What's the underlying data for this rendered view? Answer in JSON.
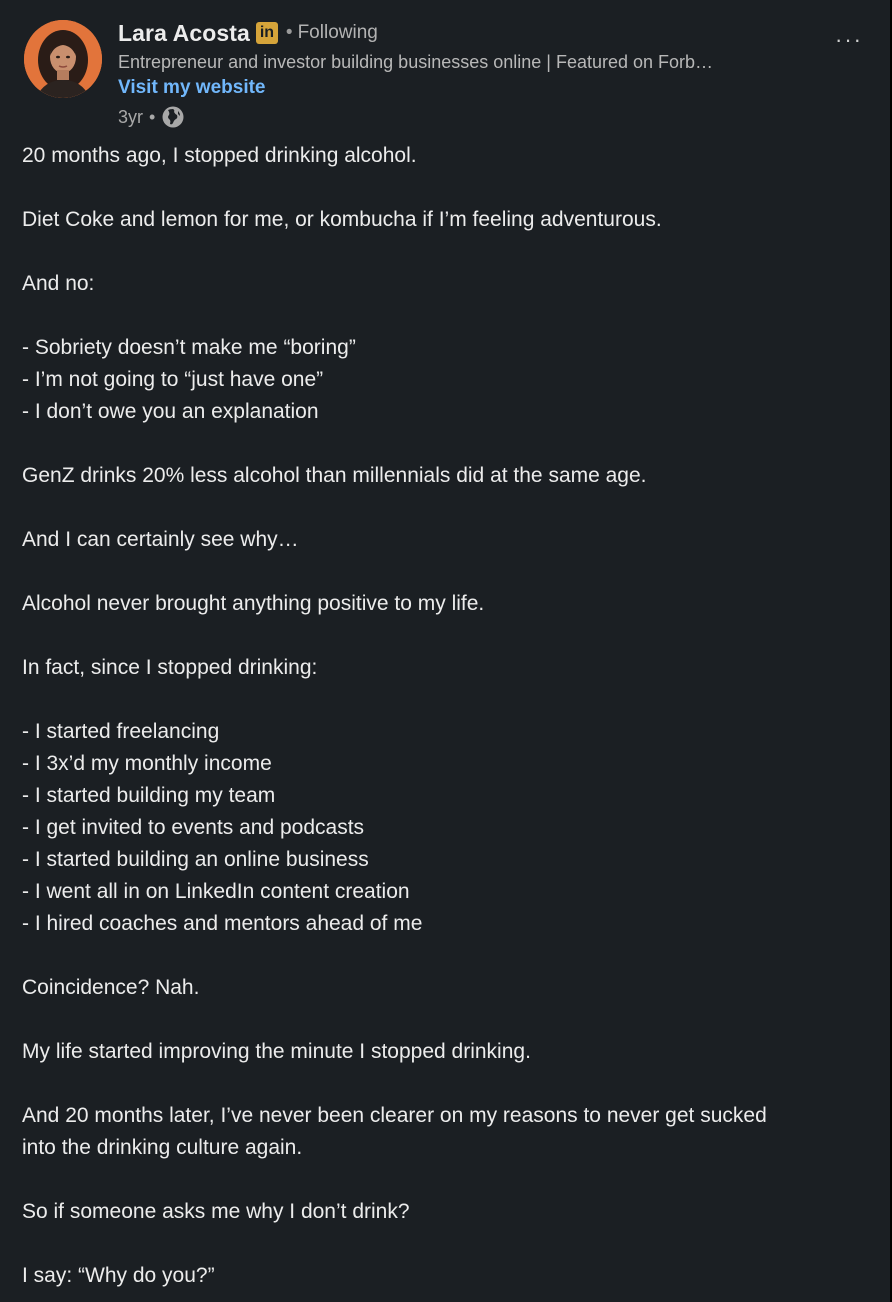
{
  "author": {
    "name": "Lara Acosta",
    "badge": "in",
    "separator": "•",
    "follow_status": "Following",
    "headline": "Entrepreneur and investor building businesses online | Featured on Forb…",
    "link_label": "Visit my website",
    "timestamp": "3yr",
    "meta_separator": "•",
    "visibility_icon": "globe-icon",
    "avatar_bg": "#e2743b"
  },
  "menu": {
    "more_icon": "more-horizontal-icon",
    "more_glyph": "···"
  },
  "colors": {
    "background": "#1b1f23",
    "text": "#ececec",
    "muted_text": "#b8b8b8",
    "link": "#71b7fb",
    "linkedin_badge": "#d6a43a"
  },
  "post": {
    "paragraphs": [
      [
        "20 months ago, I stopped drinking alcohol."
      ],
      [
        "Diet Coke and lemon for me, or kombucha if I’m feeling adventurous."
      ],
      [
        "And no:"
      ],
      [
        "- Sobriety doesn’t make me “boring”",
        "- I’m not going to “just have one”",
        "- I don’t owe you an explanation"
      ],
      [
        "GenZ drinks 20% less alcohol than millennials did at the same age."
      ],
      [
        "And I can certainly see why…"
      ],
      [
        "Alcohol never brought anything positive to my life."
      ],
      [
        "In fact, since I stopped drinking:"
      ],
      [
        "- I started freelancing",
        "- I 3x’d my monthly income",
        "- I started building my team",
        "- I get invited to events and podcasts",
        "- I started building an online business",
        "- I went all in on LinkedIn content creation",
        "- I hired coaches and mentors ahead of me"
      ],
      [
        "Coincidence? Nah."
      ],
      [
        "My life started improving the minute I stopped drinking."
      ],
      [
        "And 20 months later, I’ve never been clearer on my reasons to never get sucked",
        "into the drinking culture again."
      ],
      [
        "So if someone asks me why I don’t drink?"
      ],
      [
        "I say: “Why do you?”"
      ]
    ]
  }
}
